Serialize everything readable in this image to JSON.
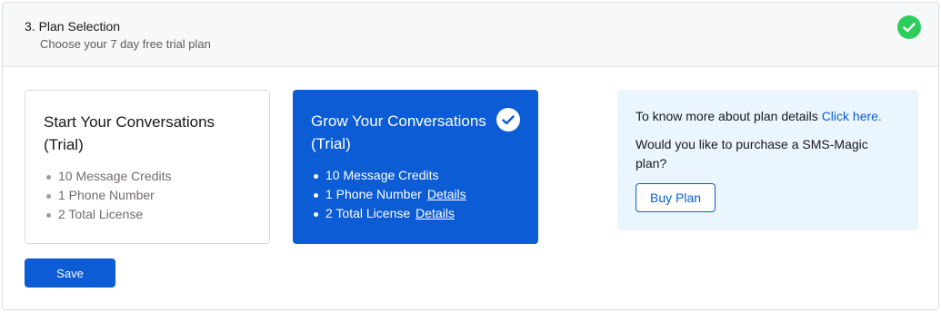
{
  "header": {
    "title": "3. Plan Selection",
    "subtitle": "Choose your 7 day free trial plan",
    "status_icon": "check-circle-icon",
    "status_color": "#2ecc5b"
  },
  "plans": [
    {
      "title": "Start Your Conversations (Trial)",
      "selected": false,
      "features": [
        "10 Message Credits",
        "1 Phone Number",
        "2 Total License"
      ]
    },
    {
      "title": "Grow Your Conversations (Trial)",
      "selected": true,
      "features": [
        "10 Message Credits",
        "1 Phone Number",
        "2 Total License"
      ],
      "details_link": "Details"
    }
  ],
  "actions": {
    "save_label": "Save"
  },
  "info": {
    "text_prefix": "To know more about plan details",
    "link_text": "Click here.",
    "question": "Would you like to purchase a SMS-Magic plan?",
    "buy_label": "Buy Plan"
  },
  "colors": {
    "accent": "#0b5cd5",
    "info_background": "#eaf5fe",
    "success": "#2ecc5b"
  }
}
